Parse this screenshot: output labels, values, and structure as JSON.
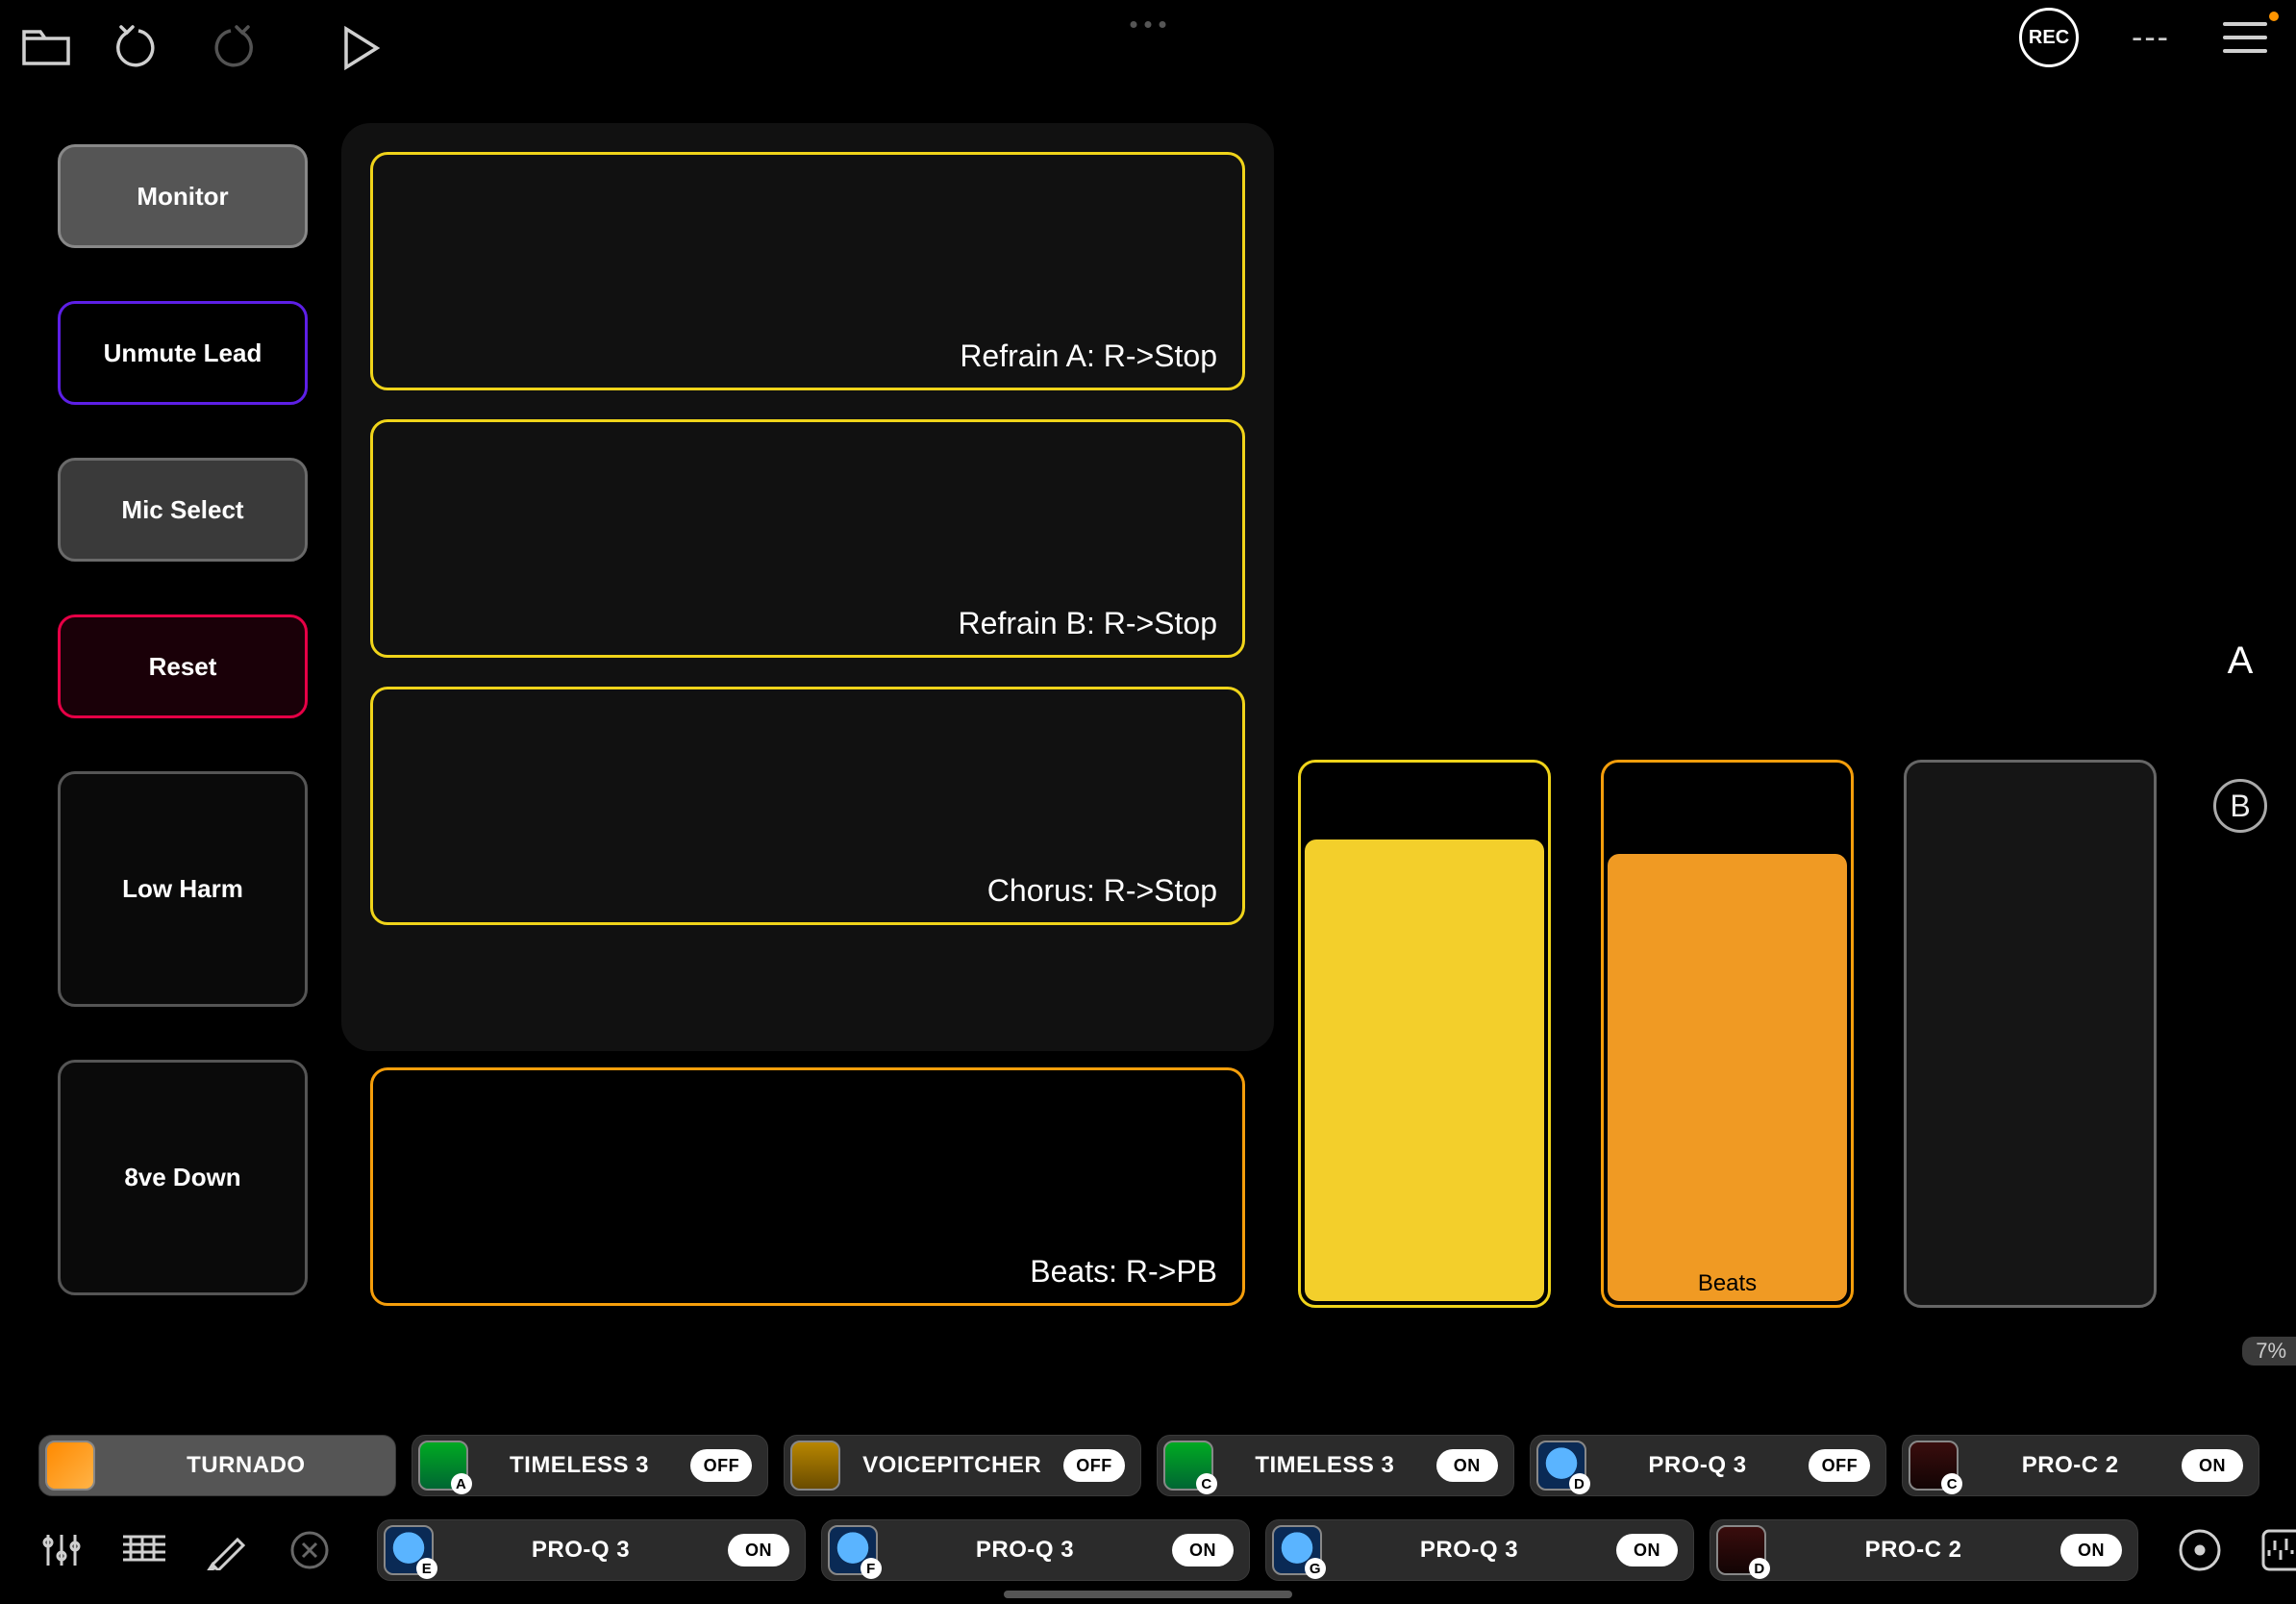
{
  "toolbar": {
    "rec_label": "REC",
    "tempo_display": "---"
  },
  "left_buttons": {
    "monitor": "Monitor",
    "unmute_lead": "Unmute Lead",
    "mic_select": "Mic Select",
    "reset": "Reset",
    "low_harm": "Low Harm",
    "eight_ve_down": "8ve Down"
  },
  "clips": {
    "refrain_a": "Refrain A: R->Stop",
    "refrain_b": "Refrain B: R->Stop",
    "chorus": "Chorus: R->Stop",
    "beats": "Beats: R->PB"
  },
  "faders": {
    "f1_label": "",
    "f2_label": "Beats",
    "f3_label": ""
  },
  "ab": {
    "a": "A",
    "b": "B"
  },
  "cpu_pct": "7%",
  "plugins_row1": [
    {
      "name": "TURNADO",
      "badge": "",
      "state": "",
      "icon": "ic-orange",
      "selected": true
    },
    {
      "name": "TIMELESS 3",
      "badge": "A",
      "state": "OFF",
      "icon": "ic-green"
    },
    {
      "name": "VOICEPITCHER",
      "badge": "",
      "state": "OFF",
      "icon": "ic-yellow"
    },
    {
      "name": "TIMELESS 3",
      "badge": "C",
      "state": "ON",
      "icon": "ic-green"
    },
    {
      "name": "PRO-Q 3",
      "badge": "D",
      "state": "OFF",
      "icon": "ic-blue"
    },
    {
      "name": "PRO-C 2",
      "badge": "C",
      "state": "ON",
      "icon": "ic-red"
    }
  ],
  "plugins_row2": [
    {
      "name": "PRO-Q 3",
      "badge": "E",
      "state": "ON",
      "icon": "ic-blue"
    },
    {
      "name": "PRO-Q 3",
      "badge": "F",
      "state": "ON",
      "icon": "ic-blue"
    },
    {
      "name": "PRO-Q 3",
      "badge": "G",
      "state": "ON",
      "icon": "ic-blue"
    },
    {
      "name": "PRO-C 2",
      "badge": "D",
      "state": "ON",
      "icon": "ic-red"
    }
  ]
}
